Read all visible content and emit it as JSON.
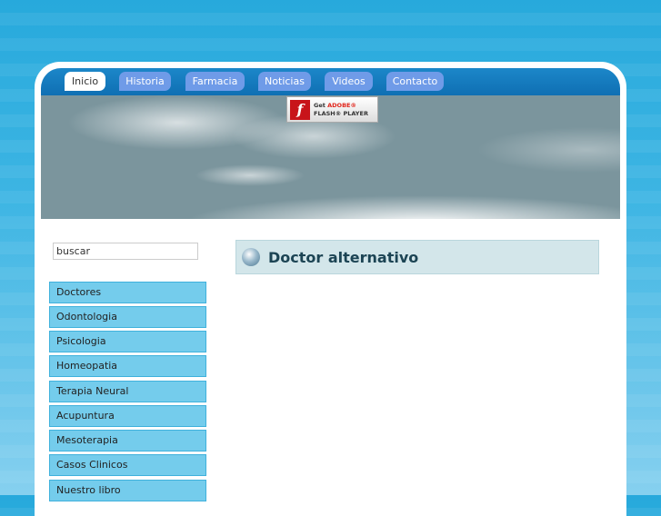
{
  "nav": {
    "tabs": [
      "Inicio",
      "Historia",
      "Farmacia",
      "Noticias",
      "Videos",
      "Contacto"
    ],
    "active": "Inicio"
  },
  "flash": {
    "get": "Get",
    "adobe": "ADOBE®",
    "player": "FLASH® PLAYER"
  },
  "search": {
    "value": "buscar"
  },
  "sidebar": {
    "items": [
      "Doctores",
      "Odontologia",
      "Psicologia",
      "Homeopatia",
      "Terapia Neural",
      "Acupuntura",
      "Mesoterapia",
      "Casos Clinicos",
      "Nuestro libro"
    ]
  },
  "main": {
    "title": "Doctor alternativo"
  }
}
